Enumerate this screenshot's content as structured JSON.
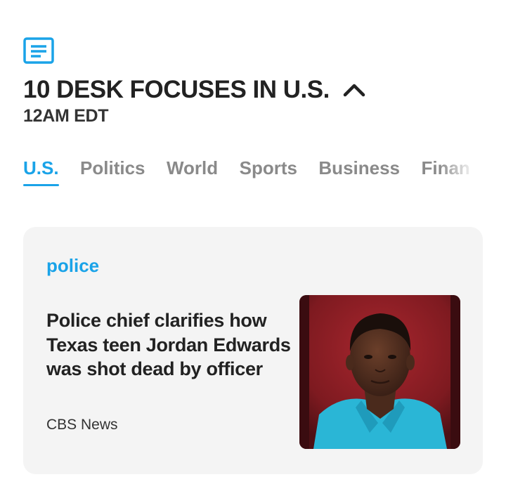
{
  "header": {
    "icon": "document-icon",
    "title": "10 DESK FOCUSES IN U.S.",
    "collapse_icon": "chevron-up-icon",
    "time": "12AM EDT"
  },
  "tabs": [
    {
      "label": "U.S.",
      "active": true
    },
    {
      "label": "Politics",
      "active": false
    },
    {
      "label": "World",
      "active": false
    },
    {
      "label": "Sports",
      "active": false
    },
    {
      "label": "Business",
      "active": false
    },
    {
      "label": "Finan",
      "active": false
    }
  ],
  "article": {
    "category": "police",
    "headline": "Police chief clarifies how Texas teen Jordan Edwards was shot dead by officer",
    "source": "CBS News"
  },
  "colors": {
    "accent": "#1aa3e8",
    "title": "#222222",
    "inactive_tab": "#8a8a8a",
    "card_bg": "#f4f4f4"
  }
}
